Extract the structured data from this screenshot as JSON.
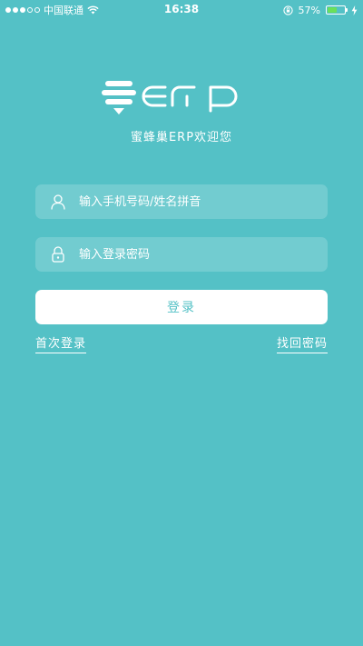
{
  "status_bar": {
    "carrier": "中国联通",
    "time": "16:38",
    "battery_percent": "57%",
    "battery_level": 0.57
  },
  "brand": {
    "subtitle": "蜜蜂巢ERP欢迎您"
  },
  "login_form": {
    "username_placeholder": "输入手机号码/姓名拼音",
    "password_placeholder": "输入登录密码",
    "login_label": "登录",
    "first_login_label": "首次登录",
    "forgot_password_label": "找回密码"
  },
  "colors": {
    "background": "#54c1c6",
    "button_text": "#54c1c6",
    "battery_fill": "#6be05a"
  }
}
